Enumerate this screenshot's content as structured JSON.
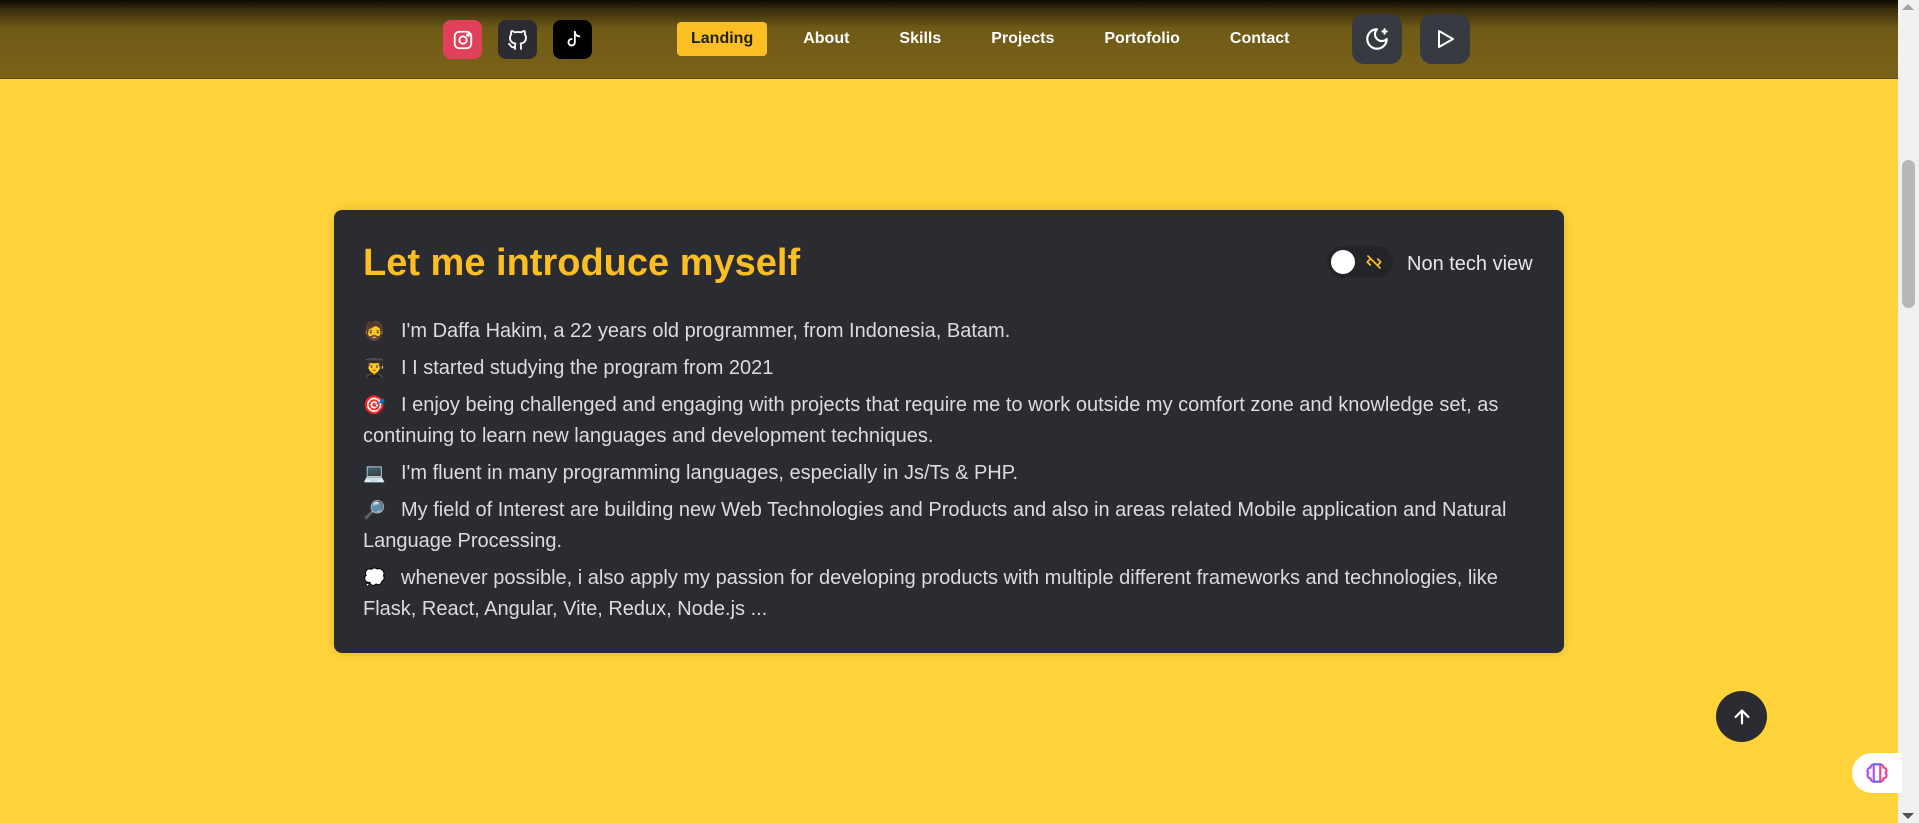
{
  "navbar": {
    "social": [
      {
        "name": "instagram",
        "icon": "instagram-icon",
        "color": "#e1405b"
      },
      {
        "name": "github",
        "icon": "github-icon",
        "color": "#2b2c31"
      },
      {
        "name": "tiktok",
        "icon": "tiktok-icon",
        "color": "#000000"
      }
    ],
    "links": [
      {
        "label": "Landing",
        "active": true
      },
      {
        "label": "About",
        "active": false
      },
      {
        "label": "Skills",
        "active": false
      },
      {
        "label": "Projects",
        "active": false
      },
      {
        "label": "Portofolio",
        "active": false
      },
      {
        "label": "Contact",
        "active": false
      }
    ],
    "theme_icon": "moon-icon",
    "play_icon": "play-icon"
  },
  "intro": {
    "title": "Let me introduce myself",
    "toggle_label": "Non tech view",
    "toggle_on": false,
    "items": [
      {
        "emoji": "🧔",
        "text": "I'm Daffa Hakim, a 22 years old programmer, from Indonesia, Batam."
      },
      {
        "emoji": "👨‍🎓",
        "text": "I I started studying the program from 2021"
      },
      {
        "emoji": "🎯",
        "text": "I enjoy being challenged and engaging with projects that require me to work outside my comfort zone and knowledge set, as continuing to learn new languages and development techniques."
      },
      {
        "emoji": "💻",
        "text": "I'm fluent in many programming languages, especially in Js/Ts & PHP."
      },
      {
        "emoji": "🔎",
        "text": "My field of Interest are building new Web Technologies and Products and also in areas related Mobile application and Natural Language Processing."
      },
      {
        "emoji": "💭",
        "text": "whenever possible, i also apply my passion for developing products with multiple different frameworks and technologies, like Flask, React, Angular, Vite, Redux, Node.js ..."
      }
    ]
  },
  "colors": {
    "background": "#ffd43b",
    "accent": "#fbbf24",
    "card": "#2b2c31"
  }
}
